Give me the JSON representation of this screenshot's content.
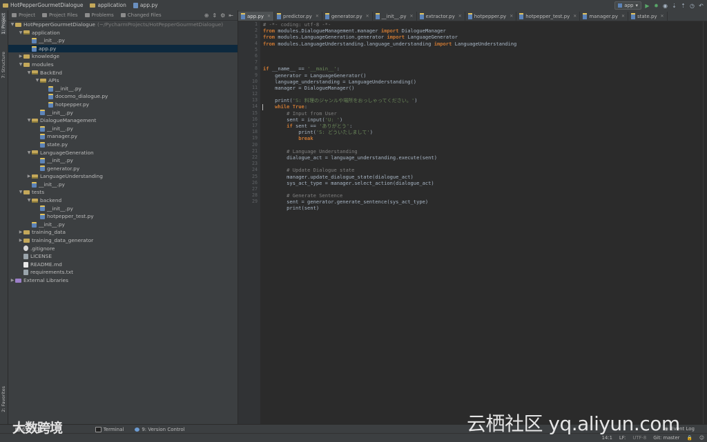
{
  "navbar": {
    "project": "HotPepperGourmetDialogue",
    "folder": "application",
    "file": "app.py"
  },
  "run": {
    "config": "app"
  },
  "left_strip": {
    "project_tab": "1: Project",
    "structure_tab": "7: Structure",
    "favorites_tab": "2: Favorites"
  },
  "panel": {
    "tabs": [
      "Project",
      "Project Files",
      "Problems",
      "Changed Files"
    ]
  },
  "tree": [
    {
      "label": "HotPepperGourmetDialogue",
      "dim": "(~/PycharmProjects/HotPepperGourmetDialogue)",
      "icon": "folder",
      "depth": 0,
      "arrow": "down"
    },
    {
      "label": "application",
      "icon": "pkg",
      "depth": 1,
      "arrow": "down"
    },
    {
      "label": "__init__.py",
      "icon": "py",
      "depth": 2,
      "arrow": "none"
    },
    {
      "label": "app.py",
      "icon": "py",
      "depth": 2,
      "arrow": "none",
      "selected": true
    },
    {
      "label": "knowledge",
      "icon": "folder",
      "depth": 1,
      "arrow": "right"
    },
    {
      "label": "modules",
      "icon": "folder",
      "depth": 1,
      "arrow": "down"
    },
    {
      "label": "BackEnd",
      "icon": "pkg",
      "depth": 2,
      "arrow": "down"
    },
    {
      "label": "APIs",
      "icon": "pkg",
      "depth": 3,
      "arrow": "down"
    },
    {
      "label": "__init__.py",
      "icon": "py",
      "depth": 4,
      "arrow": "none"
    },
    {
      "label": "docomo_dialogue.py",
      "icon": "py",
      "depth": 4,
      "arrow": "none"
    },
    {
      "label": "hotpepper.py",
      "icon": "py",
      "depth": 4,
      "arrow": "none"
    },
    {
      "label": "__init__.py",
      "icon": "py",
      "depth": 3,
      "arrow": "none"
    },
    {
      "label": "DialogueManagement",
      "icon": "pkg",
      "depth": 2,
      "arrow": "down"
    },
    {
      "label": "__init__.py",
      "icon": "py",
      "depth": 3,
      "arrow": "none"
    },
    {
      "label": "manager.py",
      "icon": "py",
      "depth": 3,
      "arrow": "none"
    },
    {
      "label": "state.py",
      "icon": "py",
      "depth": 3,
      "arrow": "none"
    },
    {
      "label": "LanguageGeneration",
      "icon": "pkg",
      "depth": 2,
      "arrow": "down"
    },
    {
      "label": "__init__.py",
      "icon": "py",
      "depth": 3,
      "arrow": "none"
    },
    {
      "label": "generator.py",
      "icon": "py",
      "depth": 3,
      "arrow": "none"
    },
    {
      "label": "LanguageUnderstanding",
      "icon": "pkg",
      "depth": 2,
      "arrow": "right"
    },
    {
      "label": "__init__.py",
      "icon": "py",
      "depth": 2,
      "arrow": "none"
    },
    {
      "label": "tests",
      "icon": "folder",
      "depth": 1,
      "arrow": "down"
    },
    {
      "label": "backend",
      "icon": "pkg",
      "depth": 2,
      "arrow": "down"
    },
    {
      "label": "__init__.py",
      "icon": "py",
      "depth": 3,
      "arrow": "none"
    },
    {
      "label": "hotpepper_test.py",
      "icon": "py",
      "depth": 3,
      "arrow": "none"
    },
    {
      "label": "__init__.py",
      "icon": "py",
      "depth": 2,
      "arrow": "none"
    },
    {
      "label": "training_data",
      "icon": "folder",
      "depth": 1,
      "arrow": "right"
    },
    {
      "label": "training_data_generator",
      "icon": "folder",
      "depth": 1,
      "arrow": "right"
    },
    {
      "label": ".gitignore",
      "icon": "git",
      "depth": 1,
      "arrow": "none"
    },
    {
      "label": "LICENSE",
      "icon": "txt",
      "depth": 1,
      "arrow": "none"
    },
    {
      "label": "README.md",
      "icon": "md",
      "depth": 1,
      "arrow": "none"
    },
    {
      "label": "requirements.txt",
      "icon": "txt",
      "depth": 1,
      "arrow": "none"
    },
    {
      "label": "External Libraries",
      "icon": "lib",
      "depth": 0,
      "arrow": "right"
    }
  ],
  "editor_tabs": [
    {
      "label": "app.py",
      "active": true
    },
    {
      "label": "predictor.py"
    },
    {
      "label": "generator.py"
    },
    {
      "label": "__init__.py"
    },
    {
      "label": "extractor.py"
    },
    {
      "label": "hotpepper.py"
    },
    {
      "label": "hotpepper_test.py"
    },
    {
      "label": "manager.py"
    },
    {
      "label": "state.py"
    }
  ],
  "code": [
    [
      [
        "cm",
        "# -*- coding: utf-8 -*-"
      ]
    ],
    [
      [
        "kw",
        "from"
      ],
      [
        "",
        " modules.DialogueManagement.manager "
      ],
      [
        "kw",
        "import"
      ],
      [
        "",
        " DialogueManager"
      ]
    ],
    [
      [
        "kw",
        "from"
      ],
      [
        "",
        " modules.LanguageGeneration.generator "
      ],
      [
        "kw",
        "import"
      ],
      [
        "",
        " LanguageGenerator"
      ]
    ],
    [
      [
        "kw",
        "from"
      ],
      [
        "",
        " modules.LanguageUnderstanding.language_understanding "
      ],
      [
        "kw",
        "import"
      ],
      [
        "",
        " LanguageUnderstanding"
      ]
    ],
    [],
    [],
    [],
    [
      [
        "kw",
        "if"
      ],
      [
        "",
        " __name__ == "
      ],
      [
        "st",
        "'__main__'"
      ],
      [
        "",
        ":"
      ]
    ],
    [
      [
        "",
        "    generator = LanguageGenerator()"
      ]
    ],
    [
      [
        "",
        "    language_understanding = LanguageUnderstanding()"
      ]
    ],
    [
      [
        "",
        "    manager = DialogueManager()"
      ]
    ],
    [],
    [
      [
        "",
        "    print("
      ],
      [
        "st",
        "'S: 料理のジャンルや場所をおっしゃってください。'"
      ],
      [
        "",
        ")"
      ]
    ],
    [
      [
        "",
        "    "
      ],
      [
        "kw",
        "while"
      ],
      [
        "",
        " "
      ],
      [
        "kw",
        "True"
      ],
      [
        "",
        ":"
      ]
    ],
    [
      [
        "",
        "        "
      ],
      [
        "cm",
        "# Input from User"
      ]
    ],
    [
      [
        "",
        "        sent = input("
      ],
      [
        "st",
        "'U: '"
      ],
      [
        "",
        ")"
      ]
    ],
    [
      [
        "",
        "        "
      ],
      [
        "kw",
        "if"
      ],
      [
        "",
        " sent == "
      ],
      [
        "st",
        "'ありがとう'"
      ],
      [
        "",
        ":"
      ]
    ],
    [
      [
        "",
        "            print("
      ],
      [
        "st",
        "'S: どういたしまして'"
      ],
      [
        "",
        ")"
      ]
    ],
    [
      [
        "",
        "            "
      ],
      [
        "kw",
        "break"
      ]
    ],
    [],
    [
      [
        "",
        "        "
      ],
      [
        "cm",
        "# Language Understanding"
      ]
    ],
    [
      [
        "",
        "        dialogue_act = language_understanding.execute(sent)"
      ]
    ],
    [],
    [
      [
        "",
        "        "
      ],
      [
        "cm",
        "# Update Dialogue state"
      ]
    ],
    [
      [
        "",
        "        manager.update_dialogue_state(dialogue_act)"
      ]
    ],
    [
      [
        "",
        "        sys_act_type = manager.select_action(dialogue_act)"
      ]
    ],
    [],
    [
      [
        "",
        "        "
      ],
      [
        "cm",
        "# Generate Sentence"
      ]
    ],
    [
      [
        "",
        "        sent = generator.generate_sentence(sys_act_type)"
      ]
    ],
    [
      [
        "",
        "        print(sent)"
      ]
    ]
  ],
  "line_numbers": [
    "1",
    "2",
    "3",
    "4",
    "5",
    "6",
    "7",
    "8",
    "9",
    "10",
    "11",
    "12",
    "13",
    "14",
    "15",
    "16",
    "17",
    "18",
    "19",
    "20",
    "21",
    "22",
    "23",
    "24",
    "25",
    "26",
    "27",
    "28",
    "29"
  ],
  "bottom": {
    "todo": "6: TODO",
    "terminal": "Terminal",
    "vcs": "9: Version Control",
    "event_log": "Event Log"
  },
  "status": {
    "position": "14:1",
    "line_sep": "LF:",
    "encoding": "UTF-8",
    "git": "Git: master"
  },
  "watermark": {
    "left": "大数跨境",
    "right": "云栖社区 yq.aliyun.com"
  }
}
